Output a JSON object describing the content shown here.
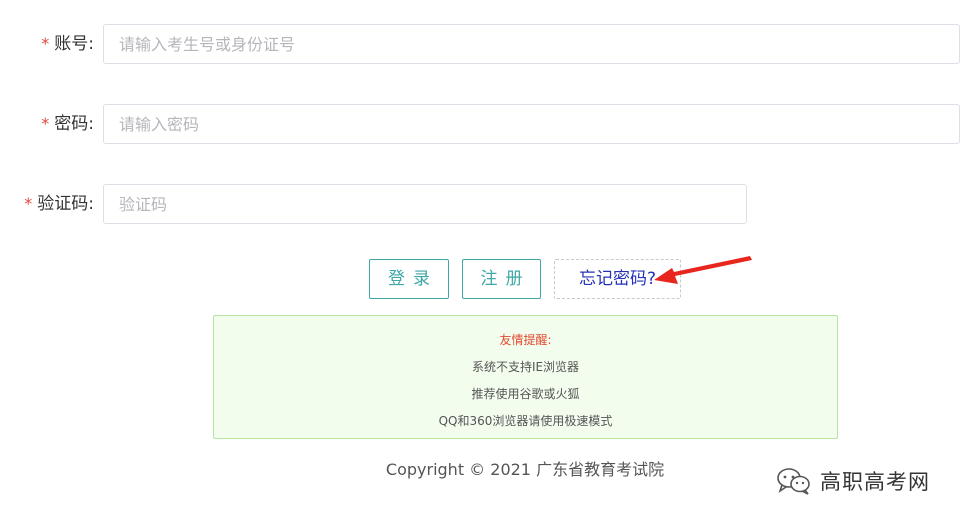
{
  "form": {
    "account": {
      "required_mark": "*",
      "label": "账号:",
      "placeholder": "请输入考生号或身份证号"
    },
    "password": {
      "required_mark": "*",
      "label": "密码:",
      "placeholder": "请输入密码"
    },
    "captcha": {
      "required_mark": "*",
      "label": "验证码:",
      "placeholder": "验证码"
    }
  },
  "actions": {
    "login_label": "登录",
    "register_label": "注册",
    "forgot_label": "忘记密码?"
  },
  "notice": {
    "title": "友情提醒:",
    "lines": [
      "系统不支持IE浏览器",
      "推荐使用谷歌或火狐",
      "QQ和360浏览器请使用极速模式"
    ]
  },
  "footer": {
    "copyright": "Copyright © 2021 广东省教育考试院"
  },
  "watermark": {
    "text": "高职高考网",
    "icon": "wechat-icon"
  },
  "annotation": {
    "icon": "red-arrow-icon",
    "color": "#e8261d"
  },
  "colors": {
    "accent": "#3fa7a6",
    "required": "#e0463d",
    "link": "#2630b8",
    "notice_bg": "#f3fdee"
  }
}
